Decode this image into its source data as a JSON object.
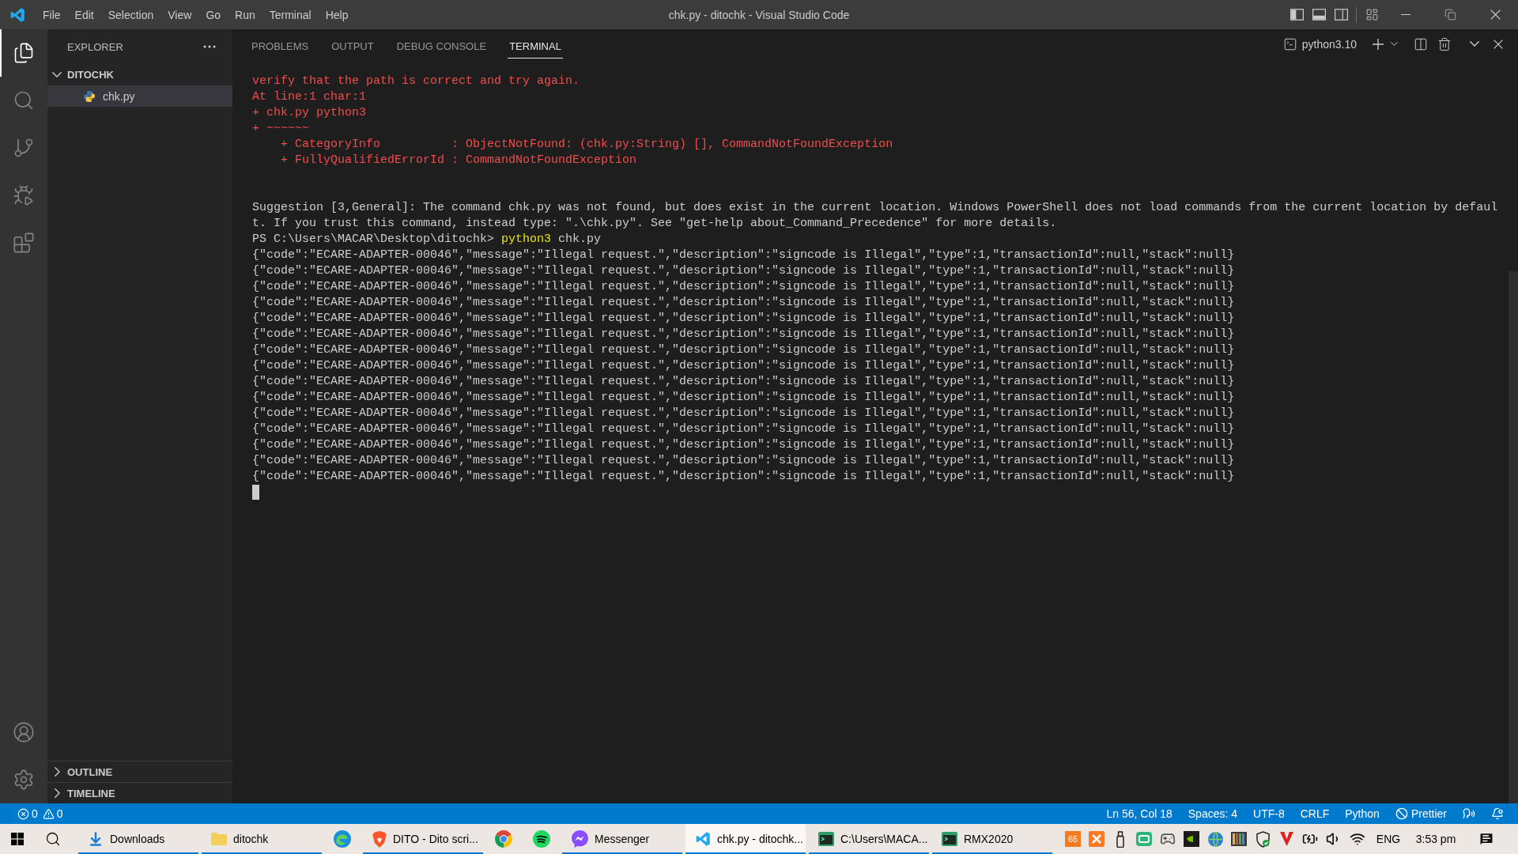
{
  "window": {
    "title": "chk.py - ditochk - Visual Studio Code",
    "layout_toggles": [
      {
        "kind": "primary_sidebar",
        "on": true
      },
      {
        "kind": "panel",
        "on": true
      },
      {
        "kind": "secondary_sidebar",
        "on": false
      }
    ]
  },
  "menu": [
    "File",
    "Edit",
    "Selection",
    "View",
    "Go",
    "Run",
    "Terminal",
    "Help"
  ],
  "activity_bar": {
    "items": [
      {
        "kind": "explorer",
        "selected": true
      },
      {
        "kind": "search",
        "selected": false
      },
      {
        "kind": "source_control",
        "selected": false
      },
      {
        "kind": "run_debug",
        "selected": false
      },
      {
        "kind": "extensions",
        "selected": false
      }
    ],
    "bottom_items": [
      {
        "kind": "accounts",
        "selected": false
      },
      {
        "kind": "manage",
        "selected": false
      }
    ]
  },
  "sidebar": {
    "title": "EXPLORER",
    "tree": [
      {
        "kind": "folder",
        "label": "DITOCHK",
        "expanded": true,
        "selected": false,
        "children": [
          {
            "kind": "python_file",
            "label": "chk.py",
            "selected": true
          }
        ]
      }
    ],
    "sections": [
      {
        "label": "OUTLINE",
        "expanded": false
      },
      {
        "label": "TIMELINE",
        "expanded": false
      }
    ]
  },
  "panel": {
    "tabs": [
      {
        "label": "PROBLEMS",
        "selected": false
      },
      {
        "label": "OUTPUT",
        "selected": false
      },
      {
        "label": "DEBUG CONSOLE",
        "selected": false
      },
      {
        "label": "TERMINAL",
        "selected": true
      }
    ],
    "terminal_name": "python3.10",
    "terminal": {
      "error_lines": [
        "verify that the path is correct and try again.",
        "At line:1 char:1",
        "+ chk.py python3",
        "+ ~~~~~~",
        "    + CategoryInfo          : ObjectNotFound: (chk.py:String) [], CommandNotFoundException",
        "    + FullyQualifiedErrorId : CommandNotFoundException"
      ],
      "suggestion_lines": [
        "Suggestion [3,General]: The command chk.py was not found, but does exist in the current location. Windows PowerShell does not load commands from the current location by defaul",
        "t. If you trust this command, instead type: \".\\chk.py\". See \"get-help about_Command_Precedence\" for more details."
      ],
      "prompt": {
        "path": "PS C:\\Users\\MACAR\\Desktop\\ditochk>",
        "command": "python3",
        "argument": "chk.py"
      },
      "output_lines": [
        "{\"code\":\"ECARE-ADAPTER-00046\",\"message\":\"Illegal request.\",\"description\":\"signcode is Illegal\",\"type\":1,\"transactionId\":null,\"stack\":null}",
        "{\"code\":\"ECARE-ADAPTER-00046\",\"message\":\"Illegal request.\",\"description\":\"signcode is Illegal\",\"type\":1,\"transactionId\":null,\"stack\":null}",
        "{\"code\":\"ECARE-ADAPTER-00046\",\"message\":\"Illegal request.\",\"description\":\"signcode is Illegal\",\"type\":1,\"transactionId\":null,\"stack\":null}",
        "{\"code\":\"ECARE-ADAPTER-00046\",\"message\":\"Illegal request.\",\"description\":\"signcode is Illegal\",\"type\":1,\"transactionId\":null,\"stack\":null}",
        "{\"code\":\"ECARE-ADAPTER-00046\",\"message\":\"Illegal request.\",\"description\":\"signcode is Illegal\",\"type\":1,\"transactionId\":null,\"stack\":null}",
        "{\"code\":\"ECARE-ADAPTER-00046\",\"message\":\"Illegal request.\",\"description\":\"signcode is Illegal\",\"type\":1,\"transactionId\":null,\"stack\":null}",
        "{\"code\":\"ECARE-ADAPTER-00046\",\"message\":\"Illegal request.\",\"description\":\"signcode is Illegal\",\"type\":1,\"transactionId\":null,\"stack\":null}",
        "{\"code\":\"ECARE-ADAPTER-00046\",\"message\":\"Illegal request.\",\"description\":\"signcode is Illegal\",\"type\":1,\"transactionId\":null,\"stack\":null}",
        "{\"code\":\"ECARE-ADAPTER-00046\",\"message\":\"Illegal request.\",\"description\":\"signcode is Illegal\",\"type\":1,\"transactionId\":null,\"stack\":null}",
        "{\"code\":\"ECARE-ADAPTER-00046\",\"message\":\"Illegal request.\",\"description\":\"signcode is Illegal\",\"type\":1,\"transactionId\":null,\"stack\":null}",
        "{\"code\":\"ECARE-ADAPTER-00046\",\"message\":\"Illegal request.\",\"description\":\"signcode is Illegal\",\"type\":1,\"transactionId\":null,\"stack\":null}",
        "{\"code\":\"ECARE-ADAPTER-00046\",\"message\":\"Illegal request.\",\"description\":\"signcode is Illegal\",\"type\":1,\"transactionId\":null,\"stack\":null}",
        "{\"code\":\"ECARE-ADAPTER-00046\",\"message\":\"Illegal request.\",\"description\":\"signcode is Illegal\",\"type\":1,\"transactionId\":null,\"stack\":null}",
        "{\"code\":\"ECARE-ADAPTER-00046\",\"message\":\"Illegal request.\",\"description\":\"signcode is Illegal\",\"type\":1,\"transactionId\":null,\"stack\":null}",
        "{\"code\":\"ECARE-ADAPTER-00046\",\"message\":\"Illegal request.\",\"description\":\"signcode is Illegal\",\"type\":1,\"transactionId\":null,\"stack\":null}"
      ]
    }
  },
  "status_bar": {
    "errors": "0",
    "warnings": "0",
    "items": [
      {
        "kind": "text",
        "label": "Ln 56, Col 18"
      },
      {
        "kind": "text",
        "label": "Spaces: 4"
      },
      {
        "kind": "text",
        "label": "UTF-8"
      },
      {
        "kind": "text",
        "label": "CRLF"
      },
      {
        "kind": "text",
        "label": "Python"
      },
      {
        "kind": "formatter",
        "label": "Prettier"
      }
    ]
  },
  "taskbar": {
    "apps": [
      {
        "kind": "downloads",
        "label": "Downloads",
        "running": true,
        "selected": false
      },
      {
        "kind": "folder",
        "label": "ditochk",
        "running": true,
        "selected": false
      },
      {
        "kind": "edge",
        "running": false,
        "selected": false
      },
      {
        "kind": "brave",
        "label": "DITO - Dito scri...",
        "running": true,
        "selected": false
      },
      {
        "kind": "chrome",
        "running": false,
        "selected": false
      },
      {
        "kind": "spotify",
        "running": false,
        "selected": false
      },
      {
        "kind": "messenger",
        "label": "Messenger",
        "running": true,
        "selected": false
      },
      {
        "kind": "vscode",
        "label": "chk.py - ditochk...",
        "running": true,
        "selected": true
      },
      {
        "kind": "console",
        "label": "C:\\Users\\MACA...",
        "running": true,
        "selected": false
      },
      {
        "kind": "console",
        "label": "RMX2020",
        "running": true,
        "selected": false
      }
    ],
    "tray": {
      "reading": "65",
      "language": "ENG",
      "clock": "3:53 pm"
    }
  }
}
